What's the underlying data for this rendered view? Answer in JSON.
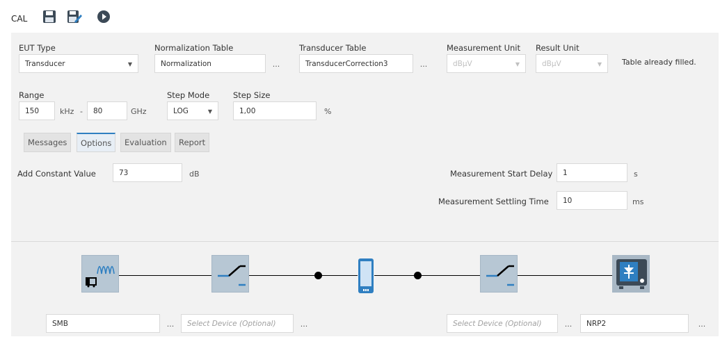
{
  "toolbar": {
    "title": "CAL",
    "icons": [
      "save-icon",
      "save-as-icon",
      "run-icon"
    ]
  },
  "form": {
    "eut_type": {
      "label": "EUT Type",
      "value": "Transducer"
    },
    "normalization_table": {
      "label": "Normalization Table",
      "value": "Normalization",
      "browse": "..."
    },
    "transducer_table": {
      "label": "Transducer Table",
      "value": "TransducerCorrection3",
      "browse": "..."
    },
    "measurement_unit": {
      "label": "Measurement Unit",
      "value": "dBµV"
    },
    "result_unit": {
      "label": "Result Unit",
      "value": "dBµV"
    },
    "status": "Table already filled.",
    "range": {
      "label": "Range",
      "start": "150",
      "start_unit": "kHz",
      "dash": "-",
      "stop": "80",
      "stop_unit": "GHz"
    },
    "step_mode": {
      "label": "Step Mode",
      "value": "LOG"
    },
    "step_size": {
      "label": "Step Size",
      "value": "1,00",
      "unit": "%"
    }
  },
  "tabs": [
    {
      "label": "Messages",
      "active": false
    },
    {
      "label": "Options",
      "active": true
    },
    {
      "label": "Evaluation",
      "active": false
    },
    {
      "label": "Report",
      "active": false
    }
  ],
  "options": {
    "add_constant": {
      "label": "Add Constant Value",
      "value": "73",
      "unit": "dB"
    },
    "start_delay": {
      "label": "Measurement Start Delay",
      "value": "1",
      "unit": "s"
    },
    "settling_time": {
      "label": "Measurement Settling Time",
      "value": "10",
      "unit": "ms"
    }
  },
  "devices": {
    "generator": {
      "value": "SMB",
      "browse": "..."
    },
    "switch_left": {
      "placeholder": "Select Device (Optional)",
      "browse": "..."
    },
    "switch_right": {
      "placeholder": "Select Device (Optional)",
      "browse": "..."
    },
    "power_meter": {
      "value": "NRP2",
      "browse": "..."
    }
  },
  "colors": {
    "accent": "#2f7fc1",
    "panel": "#f2f2f2",
    "device_tile": "#b7c7d4"
  }
}
